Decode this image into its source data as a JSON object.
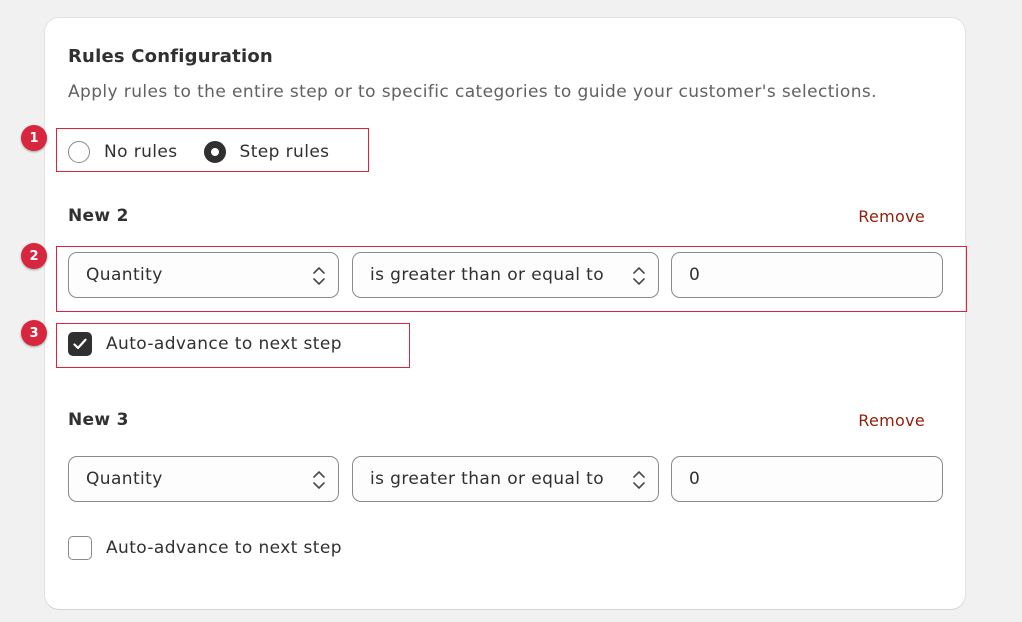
{
  "section": {
    "title": "Rules Configuration",
    "subtitle": "Apply rules to the entire step or to specific categories to guide your customer's selections."
  },
  "rule_mode": {
    "options": [
      {
        "label": "No rules",
        "selected": false
      },
      {
        "label": "Step rules",
        "selected": true
      }
    ]
  },
  "rules": [
    {
      "name": "New 2",
      "remove_label": "Remove",
      "field": "Quantity",
      "operator": "is greater than or equal to",
      "value": "0",
      "auto_advance": {
        "label": "Auto-advance to next step",
        "checked": true
      }
    },
    {
      "name": "New 3",
      "remove_label": "Remove",
      "field": "Quantity",
      "operator": "is greater than or equal to",
      "value": "0",
      "auto_advance": {
        "label": "Auto-advance to next step",
        "checked": false
      }
    }
  ],
  "annotations": [
    "1",
    "2",
    "3"
  ],
  "colors": {
    "remove_link": "#8e1f0b",
    "annotation": "#d7263d",
    "checked_fill": "#303030"
  }
}
